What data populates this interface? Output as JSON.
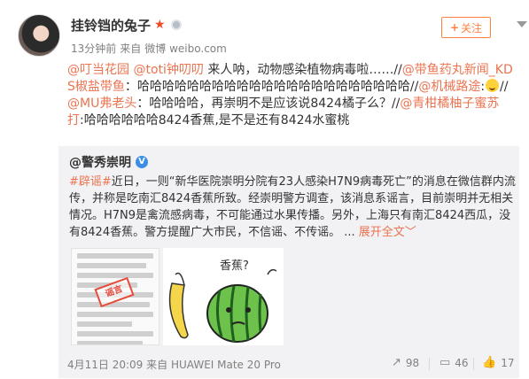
{
  "user": {
    "name": "挂铃铛的兔子",
    "time": "13分钟前",
    "source_prefix": "来自",
    "source": "微博 weibo.com"
  },
  "follow": {
    "plus": "+",
    "label": "关注"
  },
  "post": {
    "seg1": "@叮当花园",
    "seg2": " ",
    "seg3": "@toti钟叨叨",
    "seg4": " 来人呐，动物感染植物病毒啦……//",
    "seg5": "@带鱼药丸新闻_KDS椒盐带鱼",
    "seg6": "：哈哈哈哈哈哈哈哈哈哈哈哈哈哈哈哈哈哈哈哈哈哈//",
    "seg7": "@机械路途",
    "seg8": ":",
    "seg9": "//",
    "seg10": "@MU弗老头",
    "seg11": "：哈哈哈哈，再崇明不是应该说8424橘子么？//",
    "seg12": "@青柑橘柚子蜜苏打",
    "seg13": ":哈哈哈哈哈哈8424香蕉,是不是还有8424水蜜桃"
  },
  "repost": {
    "author": "@警秀崇明",
    "verified": "V",
    "tag": "#辟谣#",
    "text": "近日，一则“新华医院崇明分院有23人感染H7N9病毒死亡”的消息在微信群内流传，并称是吃南汇8424香蕉所致。经崇明警方调查，该消息系谣言，目前崇明并无相关情况。H7N9是禽流感病毒，不可能通过水果传播。另外，上海只有南汇8424西瓜，没有8424香蕉。警方提醒广大市民，不信谣、不传谣。 ...",
    "expand": "展开全文",
    "expand_caret": "﹀",
    "stamp": "谣言",
    "cartoon_text": "香蕉?"
  },
  "footer": {
    "date": "4月11日 20:09",
    "source_prefix": "来自",
    "source": "HUAWEI Mate 20 Pro",
    "reposts": "98",
    "comments": "46",
    "likes": "17"
  },
  "icons": {
    "star": "★",
    "share": "↗",
    "comment": "▭",
    "like": "👍"
  }
}
